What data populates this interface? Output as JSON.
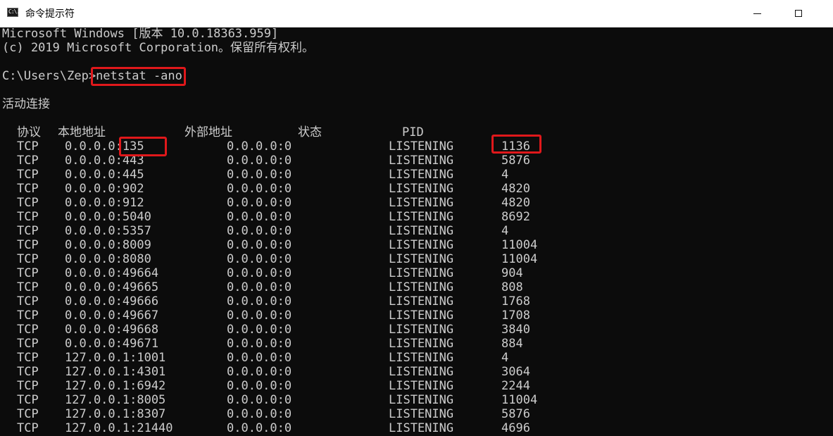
{
  "window": {
    "icon_text": "C:\\.",
    "title": "命令提示符"
  },
  "console": {
    "lines": [
      "Microsoft Windows [版本 10.0.18363.959]",
      "(c) 2019 Microsoft Corporation。保留所有权利。"
    ],
    "prompt": "C:\\Users\\Zep>",
    "command": "netstat -ano",
    "section_title": "活动连接",
    "headers": {
      "proto": "协议",
      "local": "本地地址",
      "foreign": "外部地址",
      "state": "状态",
      "pid": "PID"
    },
    "rows": [
      {
        "proto": "TCP",
        "local": "0.0.0.0:135",
        "foreign": "0.0.0.0:0",
        "state": "LISTENING",
        "pid": "1136"
      },
      {
        "proto": "TCP",
        "local": "0.0.0.0:443",
        "foreign": "0.0.0.0:0",
        "state": "LISTENING",
        "pid": "5876"
      },
      {
        "proto": "TCP",
        "local": "0.0.0.0:445",
        "foreign": "0.0.0.0:0",
        "state": "LISTENING",
        "pid": "4"
      },
      {
        "proto": "TCP",
        "local": "0.0.0.0:902",
        "foreign": "0.0.0.0:0",
        "state": "LISTENING",
        "pid": "4820"
      },
      {
        "proto": "TCP",
        "local": "0.0.0.0:912",
        "foreign": "0.0.0.0:0",
        "state": "LISTENING",
        "pid": "4820"
      },
      {
        "proto": "TCP",
        "local": "0.0.0.0:5040",
        "foreign": "0.0.0.0:0",
        "state": "LISTENING",
        "pid": "8692"
      },
      {
        "proto": "TCP",
        "local": "0.0.0.0:5357",
        "foreign": "0.0.0.0:0",
        "state": "LISTENING",
        "pid": "4"
      },
      {
        "proto": "TCP",
        "local": "0.0.0.0:8009",
        "foreign": "0.0.0.0:0",
        "state": "LISTENING",
        "pid": "11004"
      },
      {
        "proto": "TCP",
        "local": "0.0.0.0:8080",
        "foreign": "0.0.0.0:0",
        "state": "LISTENING",
        "pid": "11004"
      },
      {
        "proto": "TCP",
        "local": "0.0.0.0:49664",
        "foreign": "0.0.0.0:0",
        "state": "LISTENING",
        "pid": "904"
      },
      {
        "proto": "TCP",
        "local": "0.0.0.0:49665",
        "foreign": "0.0.0.0:0",
        "state": "LISTENING",
        "pid": "808"
      },
      {
        "proto": "TCP",
        "local": "0.0.0.0:49666",
        "foreign": "0.0.0.0:0",
        "state": "LISTENING",
        "pid": "1768"
      },
      {
        "proto": "TCP",
        "local": "0.0.0.0:49667",
        "foreign": "0.0.0.0:0",
        "state": "LISTENING",
        "pid": "1708"
      },
      {
        "proto": "TCP",
        "local": "0.0.0.0:49668",
        "foreign": "0.0.0.0:0",
        "state": "LISTENING",
        "pid": "3840"
      },
      {
        "proto": "TCP",
        "local": "0.0.0.0:49671",
        "foreign": "0.0.0.0:0",
        "state": "LISTENING",
        "pid": "884"
      },
      {
        "proto": "TCP",
        "local": "127.0.0.1:1001",
        "foreign": "0.0.0.0:0",
        "state": "LISTENING",
        "pid": "4"
      },
      {
        "proto": "TCP",
        "local": "127.0.0.1:4301",
        "foreign": "0.0.0.0:0",
        "state": "LISTENING",
        "pid": "3064"
      },
      {
        "proto": "TCP",
        "local": "127.0.0.1:6942",
        "foreign": "0.0.0.0:0",
        "state": "LISTENING",
        "pid": "2244"
      },
      {
        "proto": "TCP",
        "local": "127.0.0.1:8005",
        "foreign": "0.0.0.0:0",
        "state": "LISTENING",
        "pid": "11004"
      },
      {
        "proto": "TCP",
        "local": "127.0.0.1:8307",
        "foreign": "0.0.0.0:0",
        "state": "LISTENING",
        "pid": "5876"
      },
      {
        "proto": "TCP",
        "local": "127.0.0.1:21440",
        "foreign": "0.0.0.0:0",
        "state": "LISTENING",
        "pid": "4696"
      }
    ]
  },
  "colors": {
    "console_bg": "#0c0c0c",
    "console_text": "#cccccc",
    "highlight": "#e0181b"
  },
  "icons": [
    "cmd-app-icon",
    "minimize-icon",
    "maximize-icon"
  ]
}
